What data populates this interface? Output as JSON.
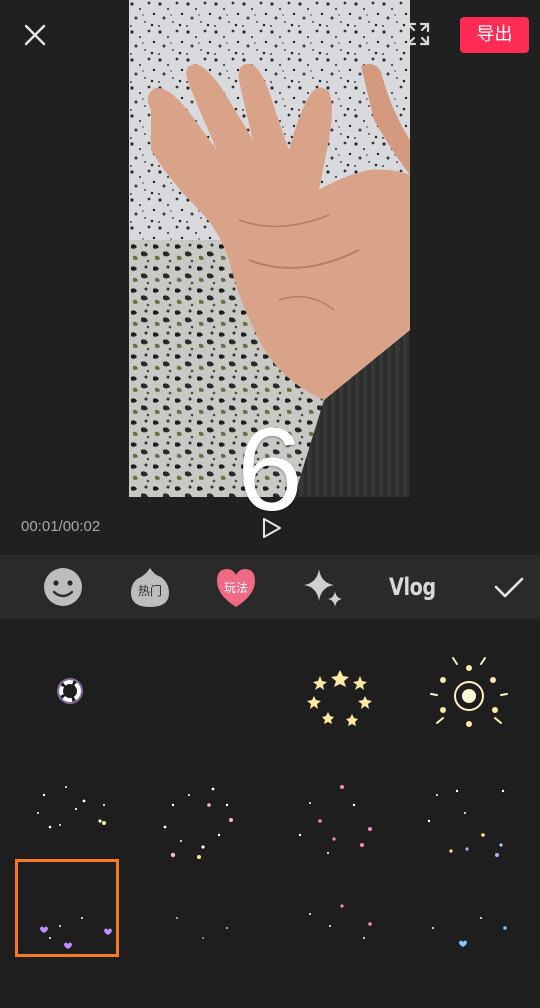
{
  "topbar": {
    "export_label": "导出",
    "accent_color": "#fe2c55"
  },
  "preview": {
    "countdown_number": "6"
  },
  "playback": {
    "timecode": "00:01/00:02"
  },
  "categories": [
    {
      "id": "emoji",
      "icon": "smiley-icon"
    },
    {
      "id": "hot",
      "label": "热门"
    },
    {
      "id": "play",
      "label": "玩法",
      "selected": true
    },
    {
      "id": "sparkle",
      "icon": "sparkle-icon"
    },
    {
      "id": "vlog",
      "label": "Vlog"
    },
    {
      "id": "confirm",
      "icon": "check-icon"
    }
  ],
  "stickers": [
    {
      "icon": "glow-ring-icon"
    },
    {
      "icon": "blank"
    },
    {
      "icon": "star-burst-icon"
    },
    {
      "icon": "sun-burst-icon"
    },
    {
      "icon": "sparkle-dots-icon"
    },
    {
      "icon": "heart-sparkles-icon"
    },
    {
      "icon": "pink-sparkles-icon"
    },
    {
      "icon": "color-sparkles-icon"
    },
    {
      "icon": "purple-hearts-icon",
      "highlighted": true
    },
    {
      "icon": "faint-dots-icon"
    },
    {
      "icon": "pink-dots-icon"
    },
    {
      "icon": "blue-hearts-icon"
    }
  ],
  "highlight_color": "#f47a23"
}
